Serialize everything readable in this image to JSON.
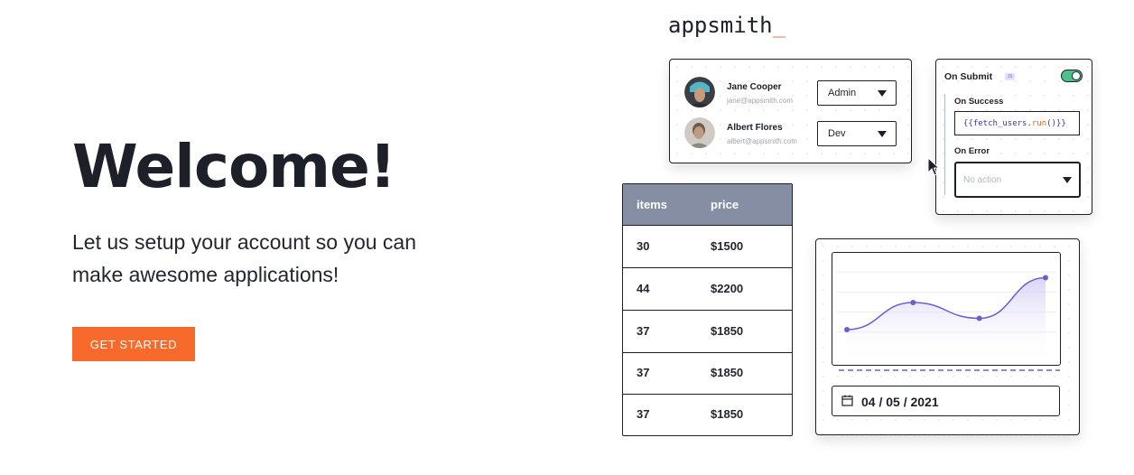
{
  "hero": {
    "title": "Welcome!",
    "subtitle": "Let us setup your account so you can make awesome applications!",
    "cta_label": "GET STARTED"
  },
  "logo": {
    "text": "appsmith",
    "cursor": "_"
  },
  "users_card": {
    "rows": [
      {
        "name": "Jane Cooper",
        "email": "jane@appsmith.com",
        "role": "Admin"
      },
      {
        "name": "Albert Flores",
        "email": "albert@appsmith.com",
        "role": "Dev"
      }
    ]
  },
  "submit_card": {
    "title": "On Submit",
    "badge": "JS",
    "toggle_on": true,
    "on_success_label": "On Success",
    "on_success_code_open": "{{",
    "on_success_code_obj": "fetch_users.",
    "on_success_code_fn": "run",
    "on_success_code_close": "()}}",
    "on_error_label": "On Error",
    "on_error_placeholder": "No action"
  },
  "table": {
    "columns": [
      "items",
      "price"
    ],
    "rows": [
      [
        "30",
        "$1500"
      ],
      [
        "44",
        "$2200"
      ],
      [
        "37",
        "$1850"
      ],
      [
        "37",
        "$1850"
      ],
      [
        "37",
        "$1850"
      ]
    ]
  },
  "chart_widget": {
    "date_value": "04 / 05 / 2021",
    "line_color": "#6b5fd0",
    "chart_data": {
      "type": "line",
      "x": [
        0,
        1,
        2,
        3
      ],
      "y": [
        1.0,
        2.2,
        1.5,
        3.3
      ],
      "ylim": [
        0,
        4
      ],
      "grid": true
    }
  },
  "colors": {
    "accent": "#f86a2b",
    "table_header": "#868ea4",
    "toggle": "#50c08a"
  }
}
